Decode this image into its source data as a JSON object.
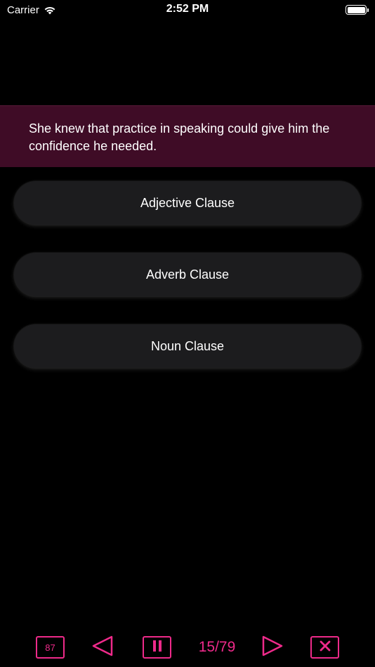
{
  "status_bar": {
    "carrier": "Carrier",
    "time": "2:52 PM"
  },
  "question": {
    "text": "She knew that practice in speaking could give him the confidence he needed."
  },
  "options": [
    {
      "label": "Adjective Clause"
    },
    {
      "label": "Adverb Clause"
    },
    {
      "label": "Noun Clause"
    }
  ],
  "toolbar": {
    "score": "87",
    "progress": "15/79",
    "icons": {
      "prev": "triangle-left-icon",
      "pause": "pause-icon",
      "next": "triangle-right-icon",
      "close": "close-icon"
    }
  },
  "colors": {
    "accent": "#ee2a8a",
    "banner": "#3f0c26",
    "option_bg": "#1c1c1e",
    "background": "#000000"
  }
}
